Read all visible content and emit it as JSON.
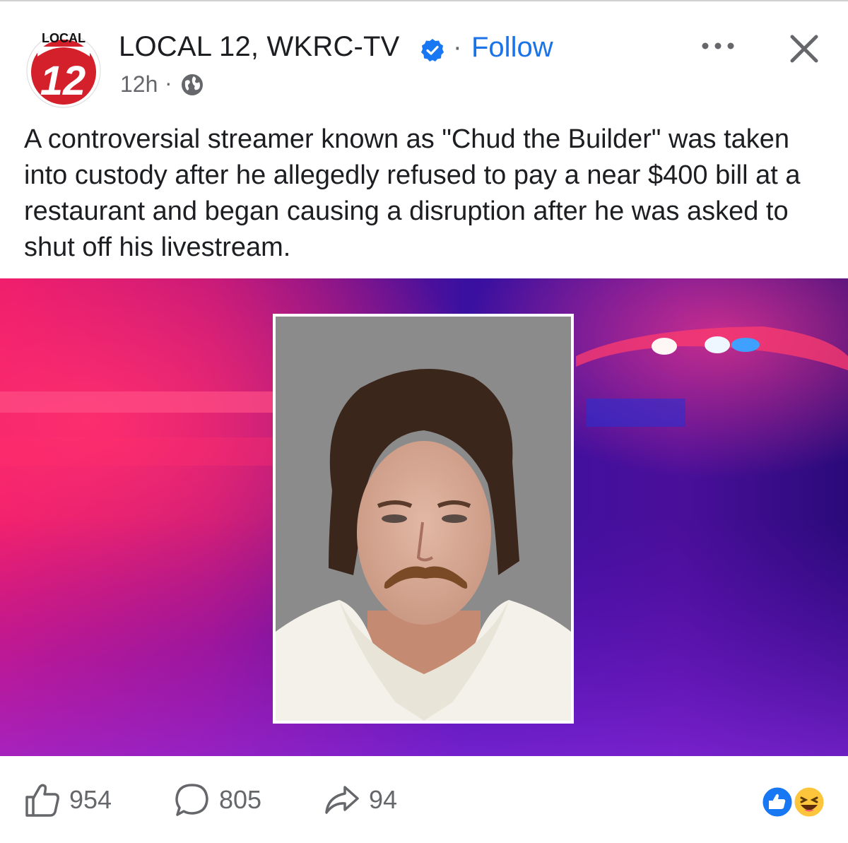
{
  "post": {
    "page_name": "LOCAL 12, WKRC-TV",
    "separator": "·",
    "follow_label": "Follow",
    "time": "12h",
    "time_separator": "·",
    "logo_top_text": "LOCAL",
    "logo_number": "12",
    "text": "A controversial streamer known as \"Chud the Builder\" was taken into custody after he allegedly refused to pay a near $400 bill at a restaurant and began causing a disruption after he was asked to shut off his livestream."
  },
  "engagement": {
    "likes": "954",
    "comments": "805",
    "shares": "94"
  },
  "icons": {
    "verified": "verified-badge-icon",
    "globe": "globe-icon",
    "more": "more-options-icon",
    "close": "close-icon",
    "like": "thumbs-up-icon",
    "comment": "comment-bubble-icon",
    "share": "share-arrow-icon",
    "reactions": [
      "like-reaction-icon",
      "haha-reaction-icon"
    ]
  },
  "colors": {
    "follow": "#1a73e8",
    "verified": "#1877f2",
    "logo_red": "#d4202a",
    "muted": "#65676b"
  }
}
